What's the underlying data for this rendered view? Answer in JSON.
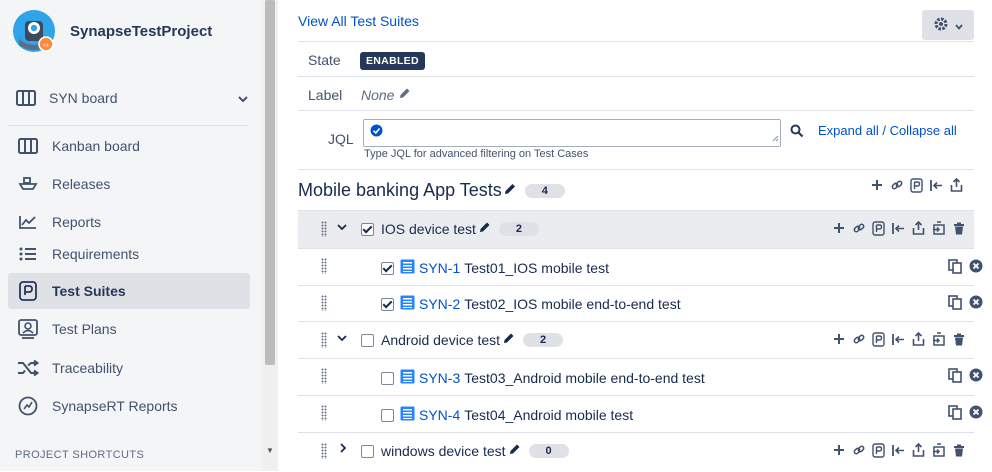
{
  "project": {
    "name": "SynapseTestProject"
  },
  "sidebar": {
    "board": "SYN board",
    "items": [
      {
        "label": "Kanban board",
        "icon": "kanban-icon"
      },
      {
        "label": "Releases",
        "icon": "ship-icon"
      },
      {
        "label": "Reports",
        "icon": "chart-icon"
      },
      {
        "label": "Requirements",
        "icon": "list-icon"
      },
      {
        "label": "Test Suites",
        "icon": "test-suites-icon",
        "active": true
      },
      {
        "label": "Test Plans",
        "icon": "test-plans-icon"
      },
      {
        "label": "Traceability",
        "icon": "shuffle-icon"
      },
      {
        "label": "SynapseRT Reports",
        "icon": "synapse-reports-icon"
      }
    ],
    "shortcuts_heading": "PROJECT SHORTCUTS"
  },
  "header": {
    "view_all": "View All Test Suites"
  },
  "fields": {
    "state_label": "State",
    "state_value": "ENABLED",
    "label_label": "Label",
    "label_value": "None",
    "jql_label": "JQL",
    "jql_value": "",
    "jql_hint": "Type JQL for advanced filtering on Test Cases",
    "expand_all": "Expand all",
    "separator": " / ",
    "collapse_all": "Collapse all"
  },
  "suite": {
    "title": "Mobile banking App Tests",
    "count": "4"
  },
  "folders": [
    {
      "name": "IOS device test",
      "count": "2",
      "checked": true,
      "expanded": true,
      "cases": [
        {
          "key": "SYN-1",
          "summary": "Test01_IOS mobile test",
          "checked": true
        },
        {
          "key": "SYN-2",
          "summary": "Test02_IOS mobile end-to-end test",
          "checked": true
        }
      ]
    },
    {
      "name": "Android device test",
      "count": "2",
      "checked": false,
      "expanded": true,
      "cases": [
        {
          "key": "SYN-3",
          "summary": "Test03_Android mobile end-to-end test",
          "checked": false
        },
        {
          "key": "SYN-4",
          "summary": "Test04_Android mobile test",
          "checked": false
        }
      ]
    },
    {
      "name": "windows device test",
      "count": "0",
      "checked": false,
      "expanded": false,
      "cases": []
    }
  ],
  "colors": {
    "link": "#0052cc",
    "badge": "#253858",
    "sidebar_bg": "#f4f5f7",
    "active_bg": "#dfe1e6"
  }
}
